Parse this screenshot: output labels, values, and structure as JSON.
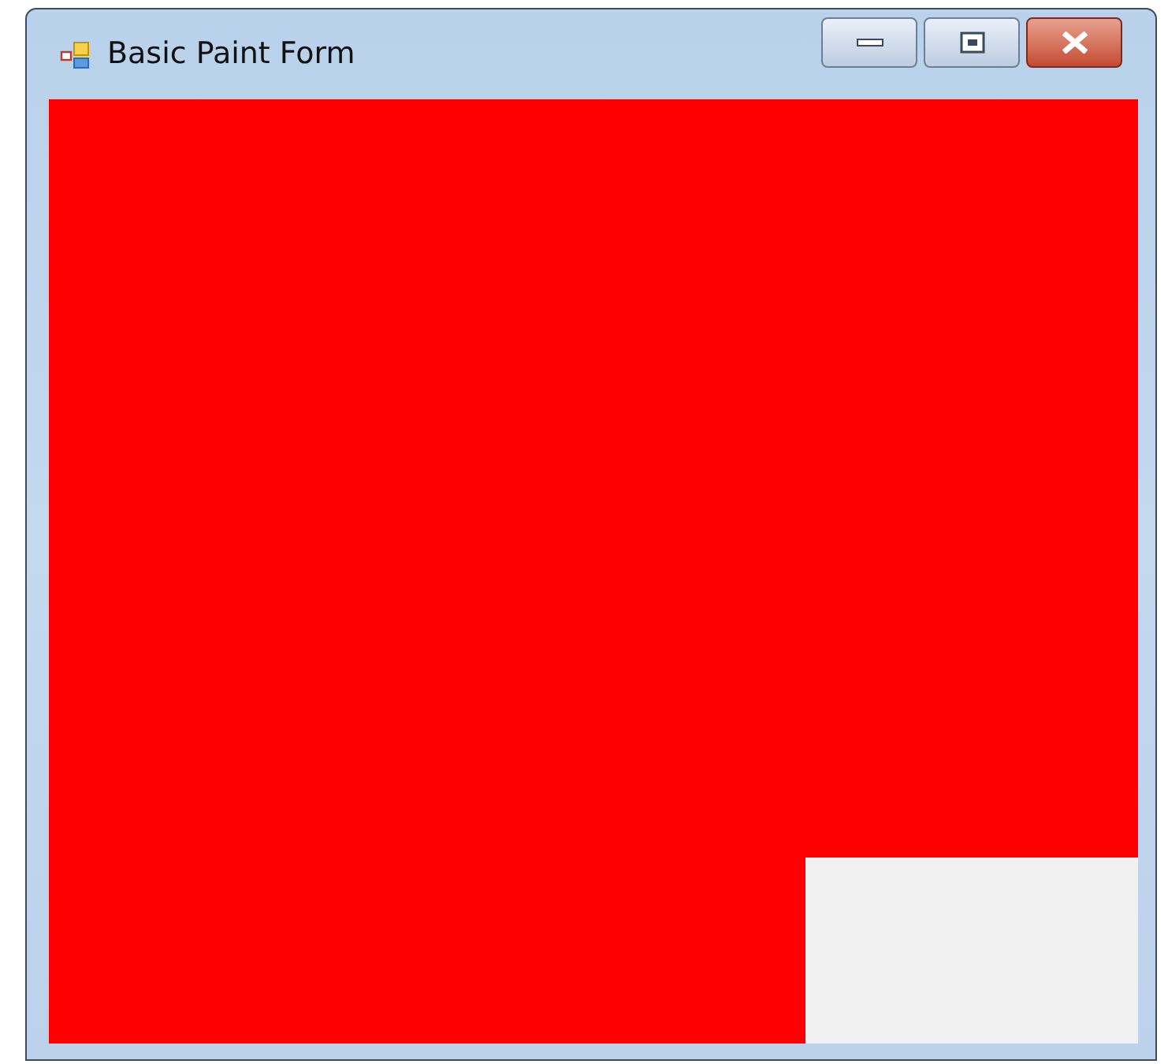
{
  "window": {
    "title": "Basic Paint Form"
  }
}
